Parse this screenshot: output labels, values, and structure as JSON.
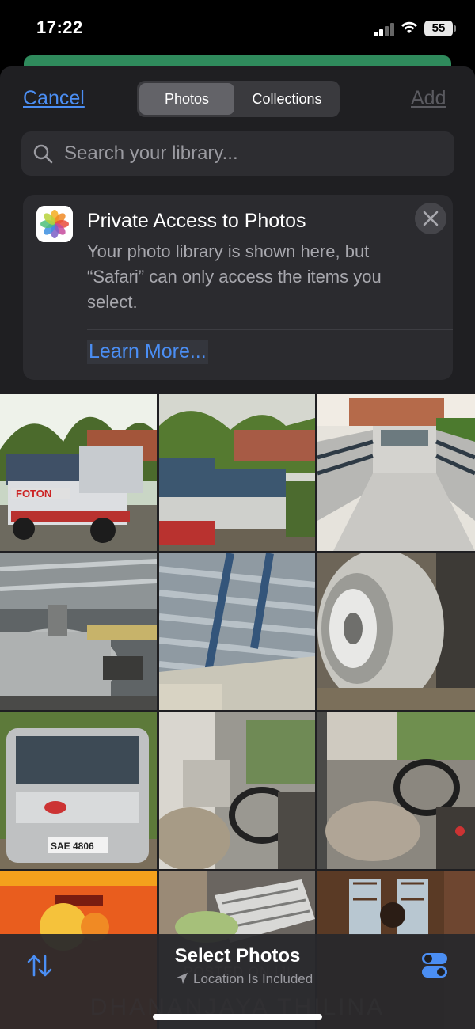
{
  "status_bar": {
    "time": "17:22",
    "battery": "55",
    "icons": [
      "cellular-signal-icon",
      "wifi-icon",
      "battery-icon"
    ]
  },
  "nav": {
    "cancel_label": "Cancel",
    "segments": [
      "Photos",
      "Collections"
    ],
    "selected_segment": "Photos",
    "add_label": "Add"
  },
  "search": {
    "placeholder": "Search your library..."
  },
  "banner": {
    "title": "Private Access to Photos",
    "body": "Your photo library is shown here, but “Safari” can only access the items you select.",
    "link_label": "Learn More..."
  },
  "grid": {
    "watermark_line1": "POSTED ON IJI",
    "watermark_line2": "DHANANJAYA THILINA",
    "photos": [
      {
        "name": "lorry-front-view-photo",
        "plate": "FOTON"
      },
      {
        "name": "lorry-side-view-photo"
      },
      {
        "name": "lorry-cargo-bed-photo"
      },
      {
        "name": "fuel-tank-underside-photo"
      },
      {
        "name": "cargo-floor-closeup-photo"
      },
      {
        "name": "rear-tyre-photo"
      },
      {
        "name": "van-front-photo",
        "plate": "SAE 4806"
      },
      {
        "name": "cab-interior-seat-photo"
      },
      {
        "name": "cab-steering-wheel-photo"
      },
      {
        "name": "poster-photo"
      },
      {
        "name": "tray-closeup-photo"
      },
      {
        "name": "room-doorway-photo"
      }
    ]
  },
  "bottom_bar": {
    "title": "Select Photos",
    "subtitle": "Location Is Included"
  },
  "colors": {
    "accent_blue": "#4b8ef3",
    "sheet_bg": "#1f1f22",
    "green_strip": "#2f8a5c"
  }
}
